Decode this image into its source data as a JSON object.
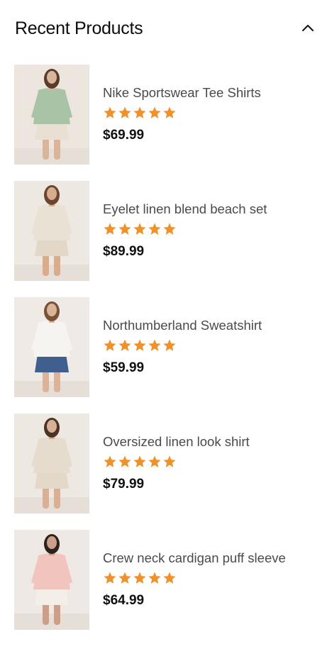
{
  "widget": {
    "title": "Recent Products",
    "collapse_icon": "chevron-up-icon",
    "star_color": "#f0922b"
  },
  "products": [
    {
      "name": "Nike Sportswear Tee Shirts",
      "price": "$69.99",
      "rating": 5,
      "image_icon": "product-photo-green-jacket",
      "image_colors": {
        "bg": "#ece6df",
        "top": "#a9c3a6",
        "bottom": "#e9dfd2",
        "skin": "#d9b59c",
        "hair": "#5b3b2a"
      }
    },
    {
      "name": "Eyelet linen blend beach set",
      "price": "$89.99",
      "rating": 5,
      "image_icon": "product-photo-eyelet-set",
      "image_colors": {
        "bg": "#eee8e2",
        "top": "#e9e1d3",
        "bottom": "#e3d8c8",
        "skin": "#d7ad8e",
        "hair": "#6a4630"
      }
    },
    {
      "name": "Northumberland Sweatshirt",
      "price": "$59.99",
      "rating": 5,
      "image_icon": "product-photo-white-shirt-jeans",
      "image_colors": {
        "bg": "#efeae6",
        "top": "#f6f4f0",
        "bottom": "#3f5f8e",
        "skin": "#d9b49a",
        "hair": "#7a5134"
      }
    },
    {
      "name": "Oversized linen look shirt",
      "price": "$79.99",
      "rating": 5,
      "image_icon": "product-photo-linen-shirt",
      "image_colors": {
        "bg": "#ede8e2",
        "top": "#e6dccd",
        "bottom": "#e4d9c9",
        "skin": "#d8b095",
        "hair": "#4d3324"
      }
    },
    {
      "name": "Crew neck cardigan puff sleeve",
      "price": "$64.99",
      "rating": 5,
      "image_icon": "product-photo-pink-cardigan",
      "image_colors": {
        "bg": "#eee9e4",
        "top": "#f2c4be",
        "bottom": "#f3eee6",
        "skin": "#caa08a",
        "hair": "#2e211b"
      }
    }
  ]
}
